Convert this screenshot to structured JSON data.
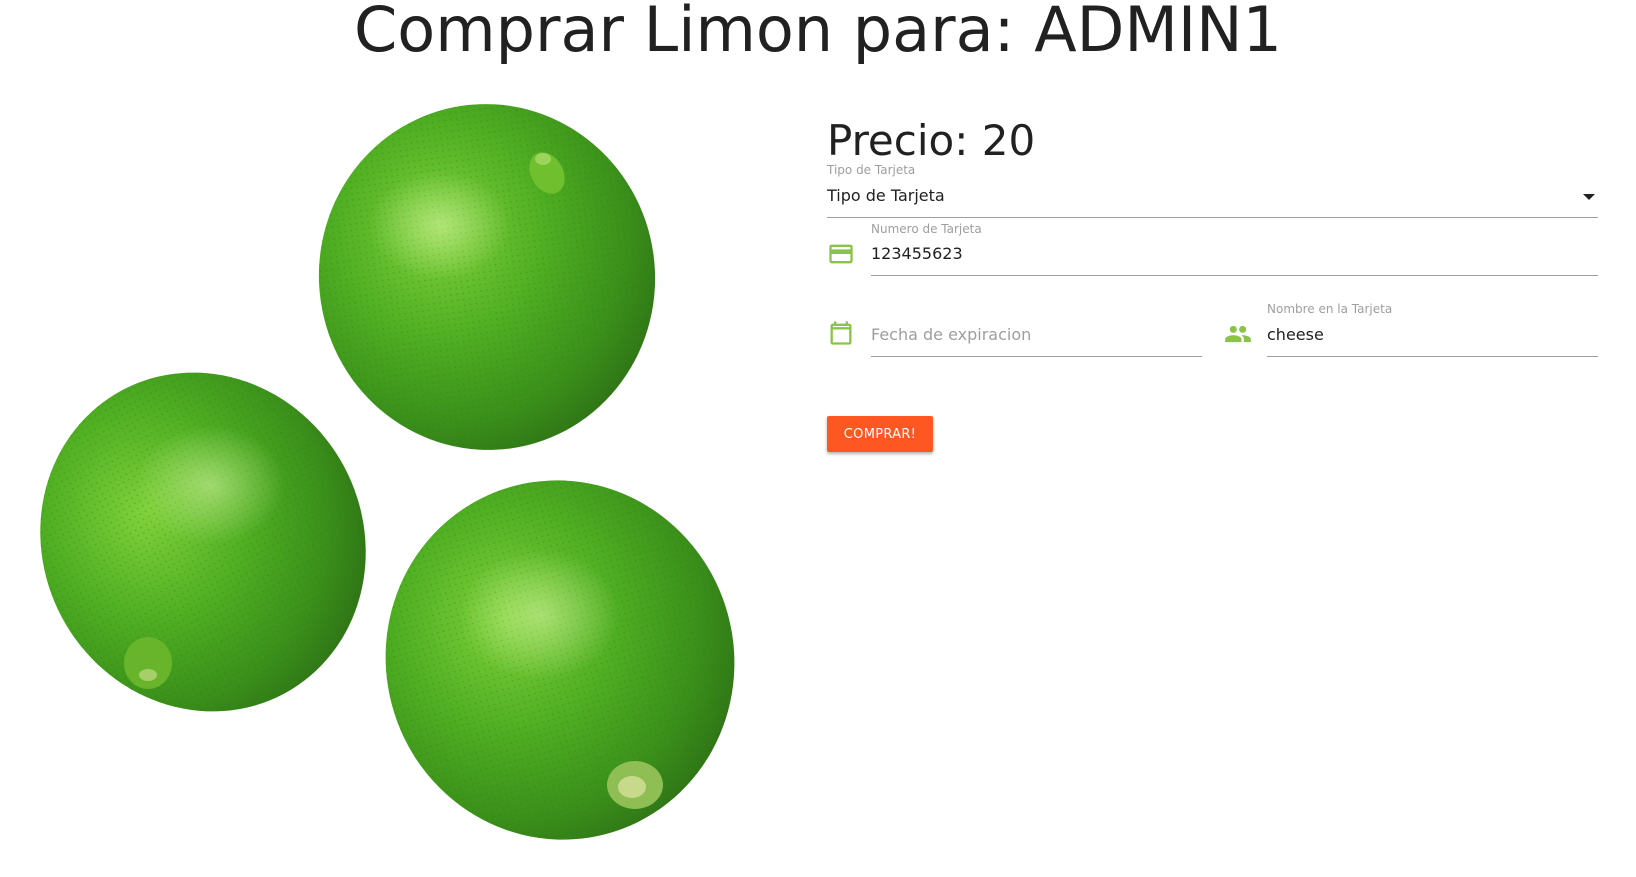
{
  "page": {
    "title": "Comprar Limon para: ADMIN1"
  },
  "product": {
    "price_text": "Precio: 20"
  },
  "form": {
    "card_type": {
      "label": "Tipo de Tarjeta",
      "value": "Tipo de Tarjeta",
      "icon": "chevron-down-icon"
    },
    "card_number": {
      "label": "Numero de Tarjeta",
      "value": "123455623",
      "icon": "credit-card-icon"
    },
    "expiration": {
      "placeholder": "Fecha de expiracion",
      "value": "",
      "icon": "calendar-icon"
    },
    "card_name": {
      "label": "Nombre en la Tarjeta",
      "value": "cheese",
      "icon": "people-icon"
    },
    "buy_button_label": "COMPRAR!"
  },
  "colors": {
    "accent": "#ff5722",
    "icon_green": "#8bc34a",
    "lime_green": "#4caf28"
  }
}
